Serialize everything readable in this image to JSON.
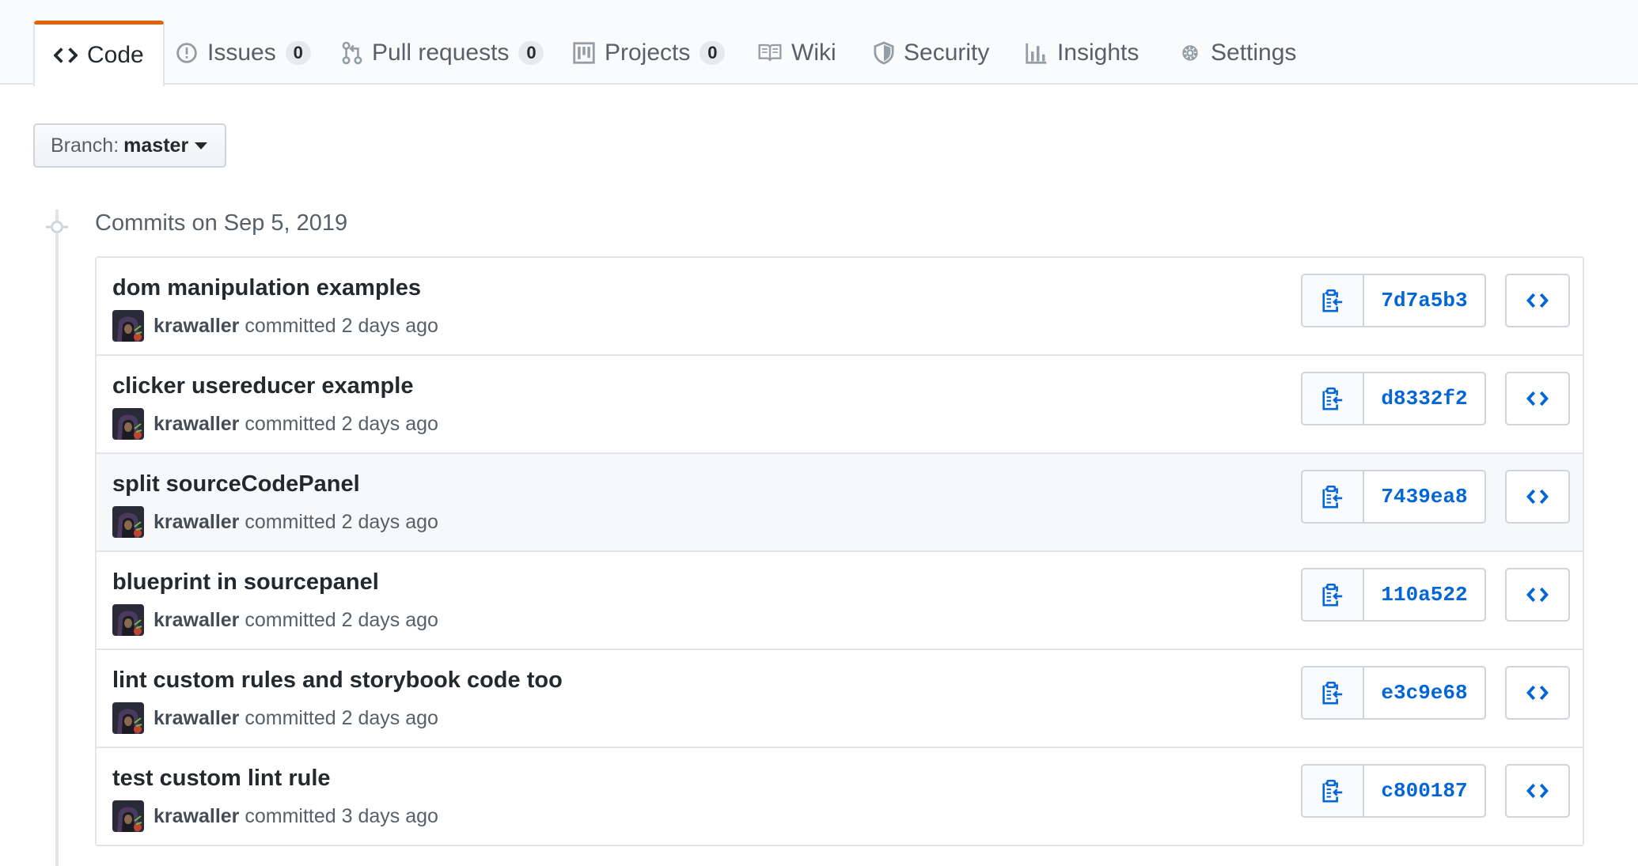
{
  "tabs": [
    {
      "label": "Code",
      "icon": "code-icon",
      "selected": true
    },
    {
      "label": "Issues",
      "icon": "issue-icon",
      "count": "0"
    },
    {
      "label": "Pull requests",
      "icon": "pull-request-icon",
      "count": "0"
    },
    {
      "label": "Projects",
      "icon": "project-icon",
      "count": "0"
    },
    {
      "label": "Wiki",
      "icon": "book-icon"
    },
    {
      "label": "Security",
      "icon": "shield-icon"
    },
    {
      "label": "Insights",
      "icon": "graph-icon"
    },
    {
      "label": "Settings",
      "icon": "gear-icon"
    }
  ],
  "branch": {
    "prefix": "Branch:",
    "name": "master"
  },
  "commit_group": {
    "title": "Commits on Sep 5, 2019"
  },
  "commits": [
    {
      "message": "dom manipulation examples",
      "author": "krawaller",
      "action": "committed",
      "time": "2 days ago",
      "sha": "7d7a5b3"
    },
    {
      "message": "clicker usereducer example",
      "author": "krawaller",
      "action": "committed",
      "time": "2 days ago",
      "sha": "d8332f2"
    },
    {
      "message": "split sourceCodePanel",
      "author": "krawaller",
      "action": "committed",
      "time": "2 days ago",
      "sha": "7439ea8",
      "hovered": true
    },
    {
      "message": "blueprint in sourcepanel",
      "author": "krawaller",
      "action": "committed",
      "time": "2 days ago",
      "sha": "110a522"
    },
    {
      "message": "lint custom rules and storybook code too",
      "author": "krawaller",
      "action": "committed",
      "time": "2 days ago",
      "sha": "e3c9e68"
    },
    {
      "message": "test custom lint rule",
      "author": "krawaller",
      "action": "committed",
      "time": "3 days ago",
      "sha": "c800187"
    }
  ],
  "colors": {
    "accent": "#e36209",
    "link": "#0366d6",
    "muted": "#586069"
  }
}
